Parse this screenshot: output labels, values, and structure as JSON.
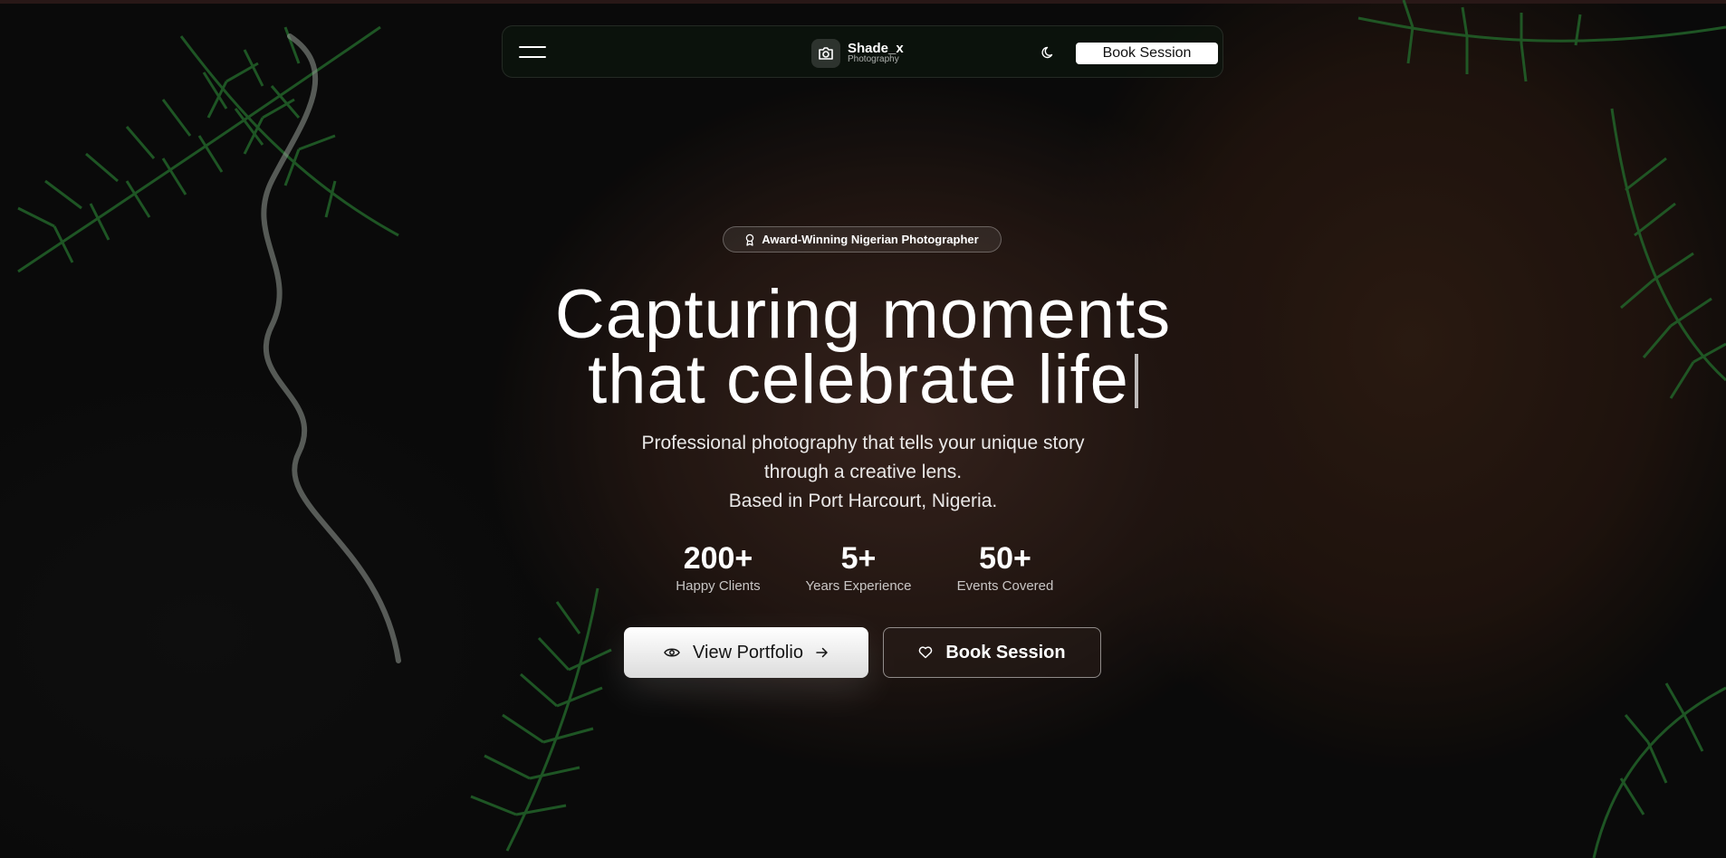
{
  "navbar": {
    "brand_name": "Shade_x",
    "brand_sub": "Photography",
    "book_label": "Book Session"
  },
  "hero": {
    "badge": "Award-Winning Nigerian Photographer",
    "headline_line1": "Capturing moments",
    "headline_line2": "that celebrate life",
    "subtext_line1": "Professional photography that tells your unique story",
    "subtext_line2": "through a creative lens.",
    "subtext_line3": "Based in Port Harcourt, Nigeria.",
    "stats": [
      {
        "value": "200+",
        "label": "Happy Clients"
      },
      {
        "value": "5+",
        "label": "Years Experience"
      },
      {
        "value": "50+",
        "label": "Events Covered"
      }
    ],
    "primary_button": "View Portfolio",
    "secondary_button": "Book Session"
  },
  "icons": {
    "menu": "hamburger-menu-icon",
    "brand": "camera-icon",
    "theme": "moon-icon",
    "badge": "award-icon",
    "portfolio": "eye-icon",
    "portfolio_arrow": "arrow-right-icon",
    "book": "heart-icon"
  },
  "colors": {
    "accent_green": "#1e6b2c",
    "primary_button_bg": "#ffffff",
    "nav_book_bg": "#ffffff"
  }
}
